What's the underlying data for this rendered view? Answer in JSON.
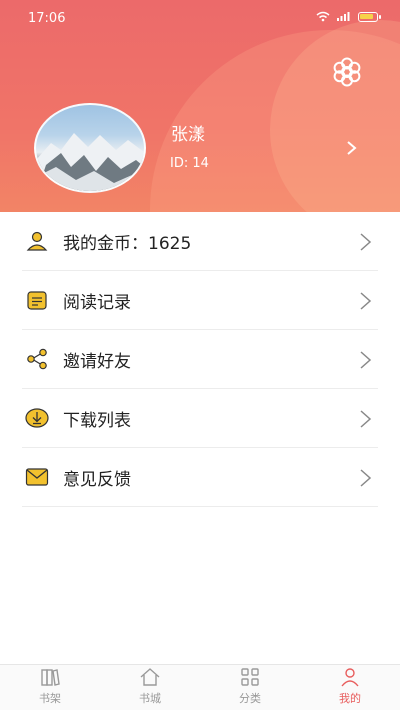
{
  "status_bar": {
    "time": "17:06",
    "signal": "4G"
  },
  "profile": {
    "name": "张漾",
    "id_label": "ID: 14"
  },
  "menu": [
    {
      "label": "我的金币：1625",
      "icon": "user-coin-icon"
    },
    {
      "label": "阅读记录",
      "icon": "document-icon"
    },
    {
      "label": "邀请好友",
      "icon": "share-icon"
    },
    {
      "label": "下载列表",
      "icon": "download-icon"
    },
    {
      "label": "意见反馈",
      "icon": "mail-icon"
    }
  ],
  "tabs": [
    {
      "label": "书架",
      "icon": "bookshelf-icon"
    },
    {
      "label": "书城",
      "icon": "home-icon"
    },
    {
      "label": "分类",
      "icon": "grid-icon"
    },
    {
      "label": "我的",
      "icon": "person-icon",
      "active": true
    }
  ],
  "colors": {
    "header": "#ee6e6a",
    "accent_yellow": "#f2c12e",
    "active_tab": "#e85d5d"
  }
}
